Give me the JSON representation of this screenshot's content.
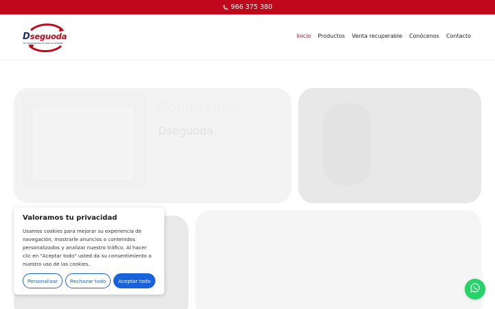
{
  "topbar": {
    "phone": "966 375 380",
    "icon": "phone-icon",
    "color": "#c1071b"
  },
  "header": {
    "logo": {
      "brand": "Dseguoda",
      "tagline": "te compramos lo que no utilizas"
    },
    "nav": [
      {
        "label": "Inicio",
        "active": true
      },
      {
        "label": "Productos",
        "active": false
      },
      {
        "label": "Venta recuperable",
        "active": false
      },
      {
        "label": "Conócenos",
        "active": false
      },
      {
        "label": "Contacto",
        "active": false
      }
    ]
  },
  "hero": {
    "card1_text_a": "Compramos",
    "card1_text_b": "Dseguoda"
  },
  "cookie_banner": {
    "title": "Valoramos tu privacidad",
    "body": "Usamos cookies para mejorar su experiencia de navegación, mostrarle anuncios o contenidos personalizados y analizar nuestro tráfico. Al hacer clic en \"Aceptar todo\" usted da su consentimiento a nuestro uso de las cookies.",
    "buttons": {
      "customize": "Personalizar",
      "reject": "Rechazar todo",
      "accept": "Aceptar todo"
    },
    "accent": "#1863dc"
  },
  "whatsapp": {
    "icon": "whatsapp-icon",
    "color": "#25d366"
  }
}
